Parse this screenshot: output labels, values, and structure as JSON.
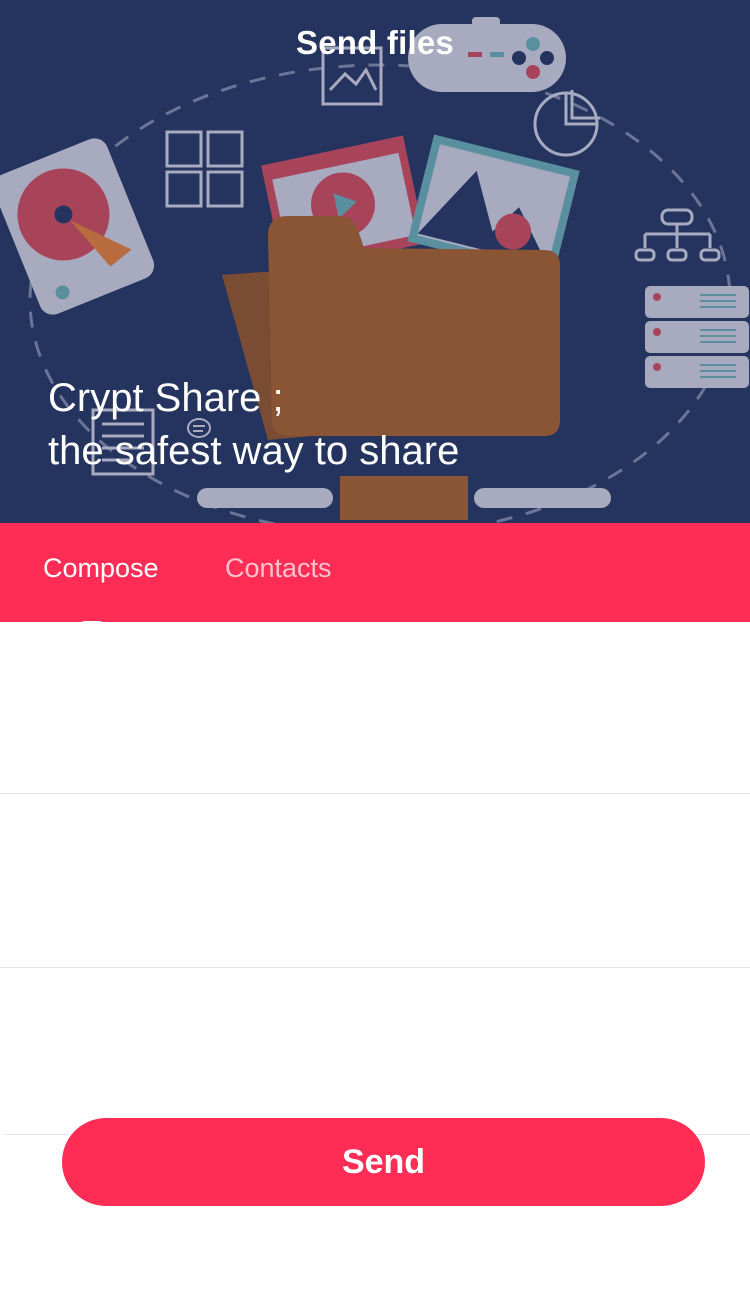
{
  "header": {
    "title": "Send files"
  },
  "hero": {
    "tagline_line1": "Crypt Share ;",
    "tagline_line2": "the safest way to share"
  },
  "tabs": [
    {
      "label": "Compose",
      "active": true
    },
    {
      "label": "Contacts",
      "active": false
    }
  ],
  "form": {
    "fields": [
      {
        "value": "",
        "placeholder": ""
      },
      {
        "value": "",
        "placeholder": ""
      },
      {
        "value": "",
        "placeholder": ""
      }
    ],
    "send_label": "Send"
  },
  "colors": {
    "accent": "#ff2d55",
    "hero_bg": "#25345f",
    "folder": "#8a5535",
    "inactive_tab_text": "#ffc3cf"
  },
  "icons": [
    "hard-drive-icon",
    "folder-icon",
    "game-controller-icon",
    "image-icon",
    "grid-icon",
    "pie-chart-icon",
    "server-icon",
    "hierarchy-icon",
    "document-icon",
    "video-player-icon",
    "chat-icon"
  ]
}
